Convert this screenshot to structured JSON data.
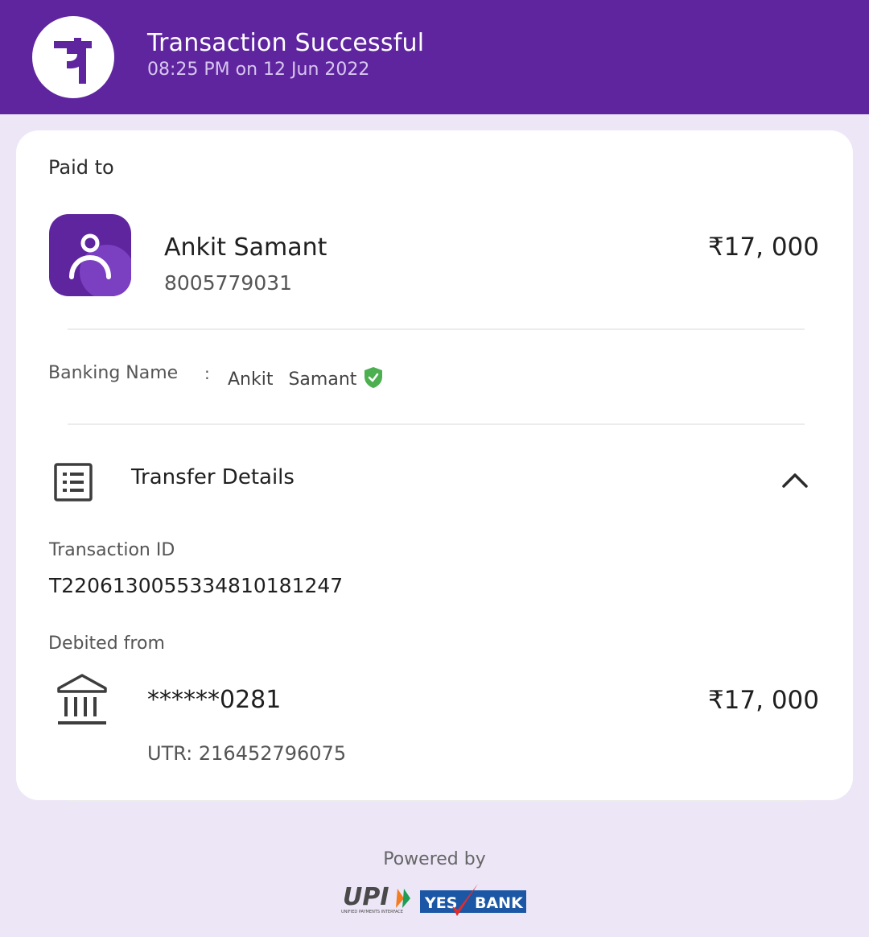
{
  "header": {
    "title": "Transaction Successful",
    "subtitle": "08:25 PM on 12 Jun 2022",
    "logo_icon": "phonepe-logo-icon",
    "brand_color": "#5f259f"
  },
  "payee": {
    "section_label": "Paid to",
    "avatar_icon": "person-icon",
    "name": "Ankit Samant",
    "phone": "8005779031",
    "amount": "₹17, 000"
  },
  "banking_name": {
    "label": "Banking Name",
    "separator": ":",
    "value": "Ankit   Samant",
    "verified_icon": "verified-shield-icon",
    "verified_color": "#4caf50"
  },
  "transfer_details": {
    "icon": "receipt-list-icon",
    "title": "Transfer Details",
    "toggle_icon": "chevron-up-icon",
    "transaction_id_label": "Transaction ID",
    "transaction_id": "T2206130055334810181247",
    "debited_from_label": "Debited from",
    "bank_icon": "bank-icon",
    "account": "******0281",
    "amount": "₹17, 000",
    "utr": "UTR: 216452796075"
  },
  "footer": {
    "powered_by": "Powered by",
    "upi_logo_text": "UPI",
    "upi_logo_subtext": "UNIFIED PAYMENTS INTERFACE",
    "bank_logo_text_left": "YES",
    "bank_logo_text_right": "BANK"
  }
}
